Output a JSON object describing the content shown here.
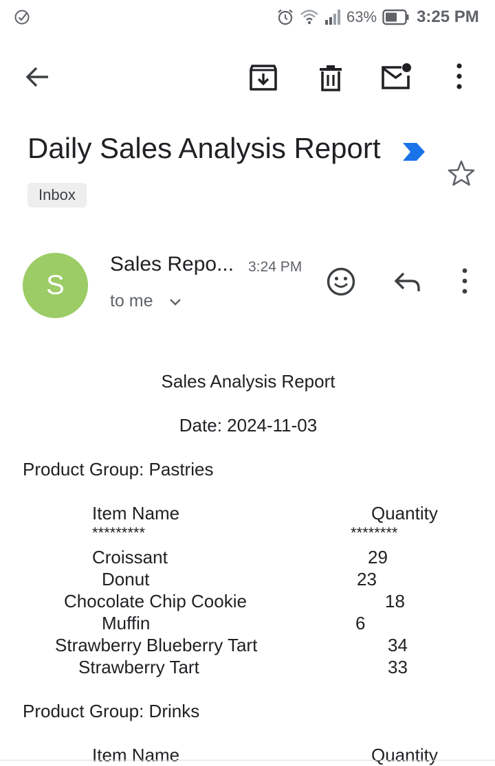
{
  "status_bar": {
    "battery_percent": "63%",
    "time": "3:25 PM",
    "icons": [
      "check-circle-icon",
      "alarm-icon",
      "wifi-icon",
      "signal-icon",
      "battery-icon"
    ]
  },
  "toolbar": {
    "icons": [
      "back-arrow-icon",
      "archive-icon",
      "delete-icon",
      "mark-unread-icon",
      "more-vert-icon"
    ]
  },
  "email": {
    "subject": "Daily Sales Analysis Report",
    "label_chip": "Inbox",
    "avatar_letter": "S",
    "sender": "Sales Repo...",
    "time": "3:24 PM",
    "recipient": "to me",
    "colors": {
      "avatar": "#9ccc65",
      "importance_marker": "#1a73e8"
    }
  },
  "report": {
    "title": "Sales Analysis Report",
    "date": "Date: 2024-11-03",
    "groups": [
      {
        "heading": "Product Group: Pastries",
        "col_item": "Item Name",
        "col_qty": "Quantity",
        "item_underline": "*********",
        "qty_underline": "********",
        "rows": [
          {
            "name": "Croissant",
            "qty": "29"
          },
          {
            "name": "Donut",
            "qty": "23"
          },
          {
            "name": "Chocolate Chip Cookie",
            "qty": "18"
          },
          {
            "name": "Muffin",
            "qty": "6"
          },
          {
            "name": "Strawberry Blueberry Tart",
            "qty": "34"
          },
          {
            "name": "Strawberry Tart",
            "qty": "33"
          }
        ]
      },
      {
        "heading": "Product Group: Drinks",
        "col_item": "Item Name",
        "col_qty": "Quantity"
      }
    ]
  }
}
